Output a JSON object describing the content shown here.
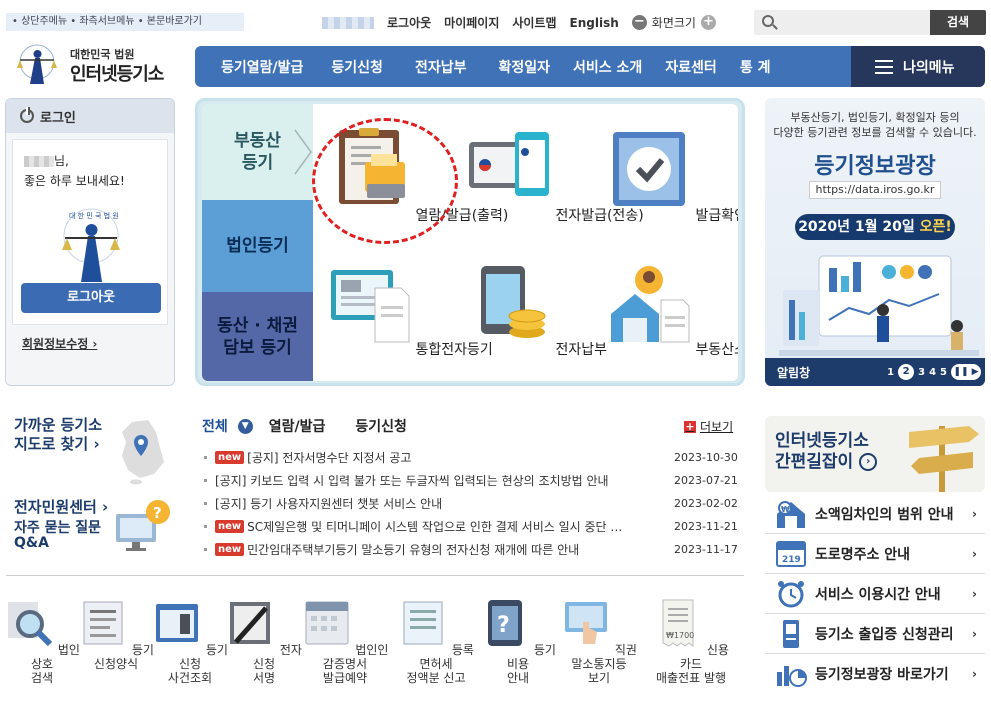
{
  "skip": {
    "text": "• 상단주메뉴 • 좌측서브메뉴 • 본문바로가기"
  },
  "util": {
    "logout": "로그아웃",
    "mypage": "마이페이지",
    "sitemap": "사이트맵",
    "english": "English",
    "zoom": "화면크기",
    "minus": "−",
    "plus": "+"
  },
  "search": {
    "placeholder": "",
    "button": "검색"
  },
  "logo": {
    "line1": "대한민국 법원",
    "line2": "인터넷등기소"
  },
  "nav": {
    "items": [
      "등기열람/발급",
      "등기신청",
      "전자납부",
      "확정일자",
      "서비스 소개",
      "자료센터",
      "통 계"
    ],
    "mymenu": "나의메뉴"
  },
  "login": {
    "title": "로그인",
    "greet1": "님,",
    "greet2": "좋은 하루 보내세요!",
    "logout_btn": "로그아웃",
    "edit": "회원정보수정 ›"
  },
  "panel": {
    "tabs": [
      "부동산\n등기",
      "법인등기",
      "동산 · 채권\n담보 등기"
    ],
    "tab1_l1": "부동산",
    "tab1_l2": "등기",
    "tab2": "법인등기",
    "tab3_l1": "동산 · 채권",
    "tab3_l2": "담보 등기",
    "services": [
      "열람/발급(출력)",
      "전자발급(전송)",
      "발급확인",
      "통합전자등기",
      "전자납부",
      "부동산소유현황"
    ]
  },
  "banner": {
    "line1": "부동산등기, 법인등기, 확정일자 등의",
    "line2": "다양한 등기관련 정보를 검색할 수 있습니다.",
    "title": "등기정보광장",
    "url": "https://data.iros.go.kr",
    "date_pre": "2020년 1월 20일 ",
    "date_em": "오픈!",
    "bar": "알림창",
    "pages": [
      "1",
      "2",
      "3",
      "4",
      "5"
    ]
  },
  "left": {
    "near1": "가까운 등기소",
    "near2": "지도로 찾기 ›",
    "center": "전자민원센터 ›",
    "faq1": "자주 묻는 질문",
    "faq2": "Q&A"
  },
  "notice": {
    "tabs": [
      "전체",
      "열람/발급",
      "등기신청"
    ],
    "more": "더보기",
    "new_label": "new",
    "rows": [
      {
        "new": true,
        "title": "[공지] 전자서명수단 지정서 공고",
        "date": "2023-10-30"
      },
      {
        "new": false,
        "title": "[공지] 키보드 입력 시 입력 불가 또는 두글자씩 입력되는 현상의 조치방법 안내",
        "date": "2023-07-21"
      },
      {
        "new": false,
        "title": "[공지] 등기 사용자지원센터 챗봇 서비스 안내",
        "date": "2023-02-02"
      },
      {
        "new": true,
        "title": "SC제일은행 및 티머니페이 시스템 작업으로 인한 결제 서비스 일시 중단 …",
        "date": "2023-11-21"
      },
      {
        "new": true,
        "title": "민간임대주택부기등기 말소등기 유형의 전자신청 재개에 따른 안내",
        "date": "2023-11-17"
      }
    ]
  },
  "quick": [
    {
      "l1": "법인상호",
      "l2": "검색"
    },
    {
      "l1": "등기",
      "l2": "신청양식"
    },
    {
      "l1": "등기신청",
      "l2": "사건조회"
    },
    {
      "l1": "전자신청",
      "l2": "서명"
    },
    {
      "l1": "법인인감증명서",
      "l2": "발급예약"
    },
    {
      "l1": "등록면허세",
      "l2": "정액분 신고"
    },
    {
      "l1": "등기비용",
      "l2": "안내"
    },
    {
      "l1": "직권말소통지등",
      "l2": "보기"
    },
    {
      "l1": "신용카드",
      "l2": "매출전표 발행"
    }
  ],
  "shortcut": {
    "l1": "인터넷등기소",
    "l2": "간편길잡이"
  },
  "rlist": [
    "소액임차인의 범위 안내",
    "도로명주소 안내",
    "서비스 이용시간 안내",
    "등기소 출입증 신청관리",
    "등기정보광장 바로가기"
  ],
  "colors": {
    "nav": "#3f72b7",
    "mymenu": "#27365b",
    "new": "#d83a2e",
    "tab_active": "#d9f0ef",
    "tab_corp": "#5c9fd6",
    "tab_movable": "#5467a6"
  }
}
